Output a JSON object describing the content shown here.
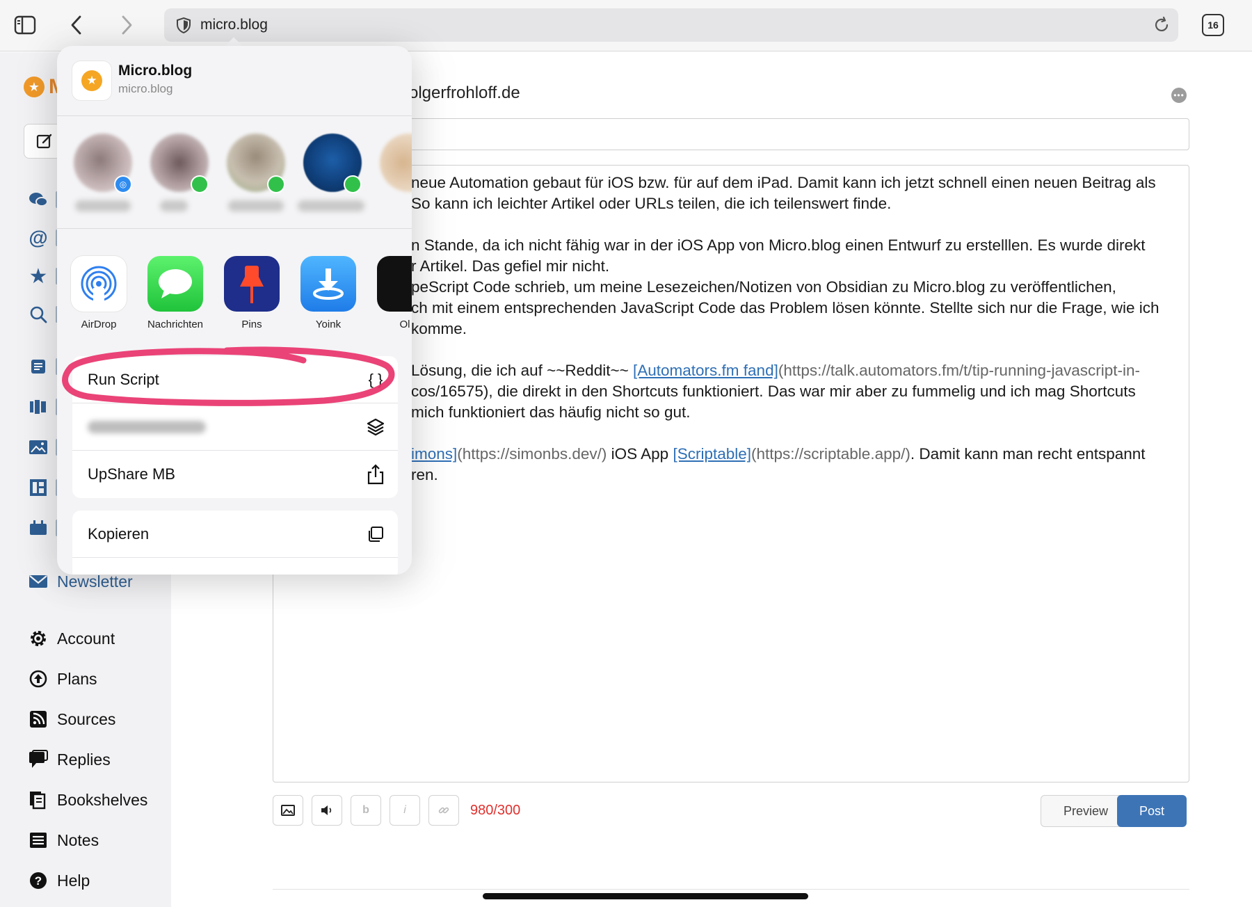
{
  "browser": {
    "url": "micro.blog",
    "tab_count": "16"
  },
  "sidebar": {
    "logo_fragment": "M",
    "items": [
      {
        "label": "Newsletter",
        "icon": "mail-icon"
      },
      {
        "label": "Account",
        "icon": "gear-icon"
      },
      {
        "label": "Plans",
        "icon": "plans-icon"
      },
      {
        "label": "Sources",
        "icon": "rss-icon"
      },
      {
        "label": "Replies",
        "icon": "replies-icon"
      },
      {
        "label": "Bookshelves",
        "icon": "bookshelves-icon"
      },
      {
        "label": "Notes",
        "icon": "notes-icon"
      },
      {
        "label": "Help",
        "icon": "help-icon"
      }
    ]
  },
  "editor": {
    "domain": "olgerfrohloff.de",
    "lines": [
      {
        "text": "neue Automation gebaut für iOS bzw. für auf dem iPad. Damit kann ich jetzt schnell einen neuen Beitrag als"
      },
      {
        "text": "So kann ich leichter Artikel oder URLs teilen, die ich teilenswert finde."
      },
      {
        "text": "n Stande, da ich nicht fähig war in der iOS App von Micro.blog einen Entwurf zu erstelllen. Es wurde direkt"
      },
      {
        "text": "r Artikel. Das gefiel mir nicht."
      },
      {
        "text": "peScript Code schrieb, um meine Lesezeichen/Notizen von Obsidian zu Micro.blog zu veröffentlichen,"
      },
      {
        "text": "ch mit einem entsprechenden JavaScript Code das Problem lösen könnte. Stellte sich nur die Frage, wie ich"
      },
      {
        "text": "komme."
      },
      {
        "prefix": "Lösung, die ich auf ~~Reddit~~ ",
        "link": "[Automators.fm fand]",
        "url": "(https://talk.automators.fm/t/tip-running-javascript-in-"
      },
      {
        "text": "cos/16575), die direkt in den Shortcuts funktioniert. Das war mir aber zu fummelig und ich mag Shortcuts"
      },
      {
        "text": "mich funktioniert das häufig nicht so gut."
      },
      {
        "link": "imons]",
        "url": "(https://simonbs.dev/)",
        "mid": " iOS App ",
        "link2": "[Scriptable]",
        "url2": "(https://scriptable.app/)",
        "suffix": ". Damit kann man recht entspannt"
      },
      {
        "text": "ren."
      }
    ],
    "toolbar": {
      "bold": "b",
      "italic": "i",
      "counter": "980/300",
      "preview": "Preview",
      "post": "Post"
    }
  },
  "share_sheet": {
    "app_name": "Micro.blog",
    "app_domain": "micro.blog",
    "apps": [
      {
        "label": "AirDrop"
      },
      {
        "label": "Nachrichten"
      },
      {
        "label": "Pins"
      },
      {
        "label": "Yoink"
      },
      {
        "label": "Ol"
      }
    ],
    "actions": [
      {
        "label": "Run Script",
        "icon": "{ }"
      },
      {
        "label": "",
        "icon": "layers-icon"
      },
      {
        "label": "UpShare MB",
        "icon": "share-icon"
      }
    ],
    "actions2": [
      {
        "label": "Kopieren",
        "icon": "copy-icon"
      }
    ],
    "highlight_color": "#e8336b"
  },
  "colors": {
    "accent": "#3d74b6",
    "link": "#2e6fb5",
    "counter_over": "#e0302d",
    "sidebar_nav": "#2f5f94"
  }
}
